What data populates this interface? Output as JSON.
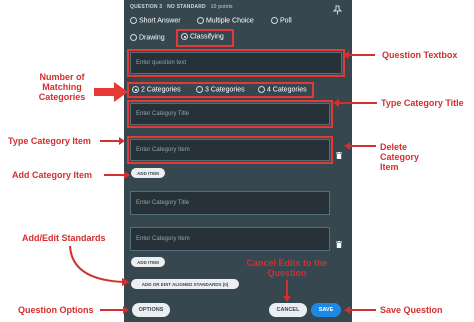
{
  "header": {
    "question_label": "QUESTION 3",
    "standard_label": "NO STANDARD",
    "points_label": "10 points"
  },
  "question_types": [
    {
      "label": "Short Answer",
      "selected": false
    },
    {
      "label": "Multiple Choice",
      "selected": false
    },
    {
      "label": "Poll",
      "selected": false
    },
    {
      "label": "Drawing",
      "selected": false
    },
    {
      "label": "Classifying",
      "selected": true
    }
  ],
  "question_text": {
    "placeholder": "Enter question text"
  },
  "category_counts": [
    {
      "label": "2 Categories",
      "selected": true
    },
    {
      "label": "3 Categories",
      "selected": false
    },
    {
      "label": "4 Categories",
      "selected": false
    }
  ],
  "category_title": {
    "placeholder": "Enter Category Title"
  },
  "category_items": [
    {
      "placeholder": "Enter Category Item"
    },
    {
      "placeholder": "Enter Category Title"
    },
    {
      "placeholder": "Enter Category Item"
    }
  ],
  "buttons": {
    "add_item": "ADD ITEM",
    "add_item_2": "ADD ITEM",
    "standards": "ADD OR EDIT ALIGNED STANDARDS (0)",
    "options": "OPTIONS",
    "cancel": "CANCEL",
    "save": "SAVE"
  },
  "icons": {
    "pin": "pin-icon",
    "trash": "trash-icon"
  },
  "colors": {
    "panel": "#37474f",
    "field": "#263238",
    "save": "#1e88e5",
    "annotation": "#d32f2f"
  },
  "annotations": {
    "question_textbox": "Question Textbox",
    "matching_categories": "Number of Matching Categories",
    "type_category_title": "Type Category Title",
    "type_category_item": "Type Category Item",
    "delete_category_item": "Delete Category Item",
    "add_category_item": "Add Category Item",
    "add_edit_standards": "Add/Edit Standards",
    "cancel_edits": "Cancel Edits to the Question",
    "question_options": "Question Options",
    "save_question": "Save Question"
  }
}
